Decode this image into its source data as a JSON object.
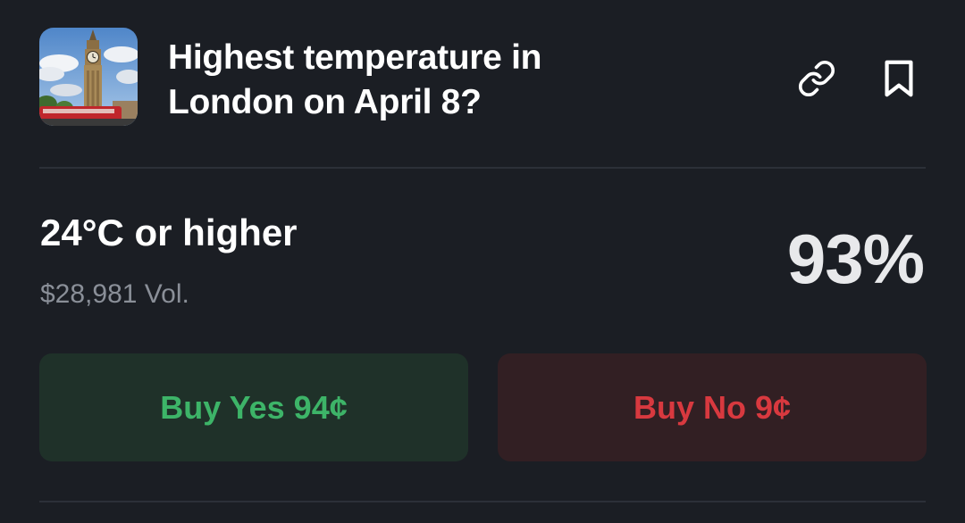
{
  "market": {
    "title": "Highest temperature in London on April 8?",
    "thumbnail_alt": "Big Ben clock tower with red bus"
  },
  "actions": {
    "link_icon": "link-icon",
    "bookmark_icon": "bookmark-icon"
  },
  "outcome": {
    "label": "24°C or higher",
    "volume": "$28,981 Vol.",
    "probability": "93%"
  },
  "buttons": {
    "yes_label": "Buy Yes 94¢",
    "no_label": "Buy No 9¢"
  },
  "colors": {
    "background": "#1b1e24",
    "yes_bg": "#1f3129",
    "yes_text": "#3db468",
    "no_bg": "#321f23",
    "no_text": "#d8393f"
  }
}
